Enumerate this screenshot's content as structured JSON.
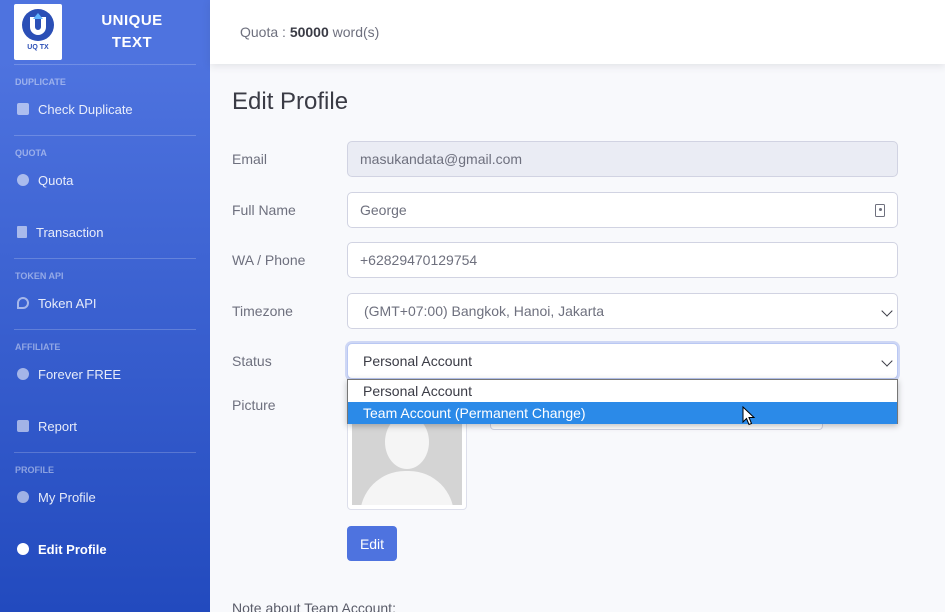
{
  "brand": {
    "logo_text": "UQ TX",
    "name_line1": "UNIQUE",
    "name_line2": "TEXT"
  },
  "sidebar": {
    "sections": [
      {
        "heading": "DUPLICATE",
        "items": [
          {
            "label": "Check Duplicate",
            "icon": "document-icon"
          }
        ]
      },
      {
        "heading": "QUOTA",
        "items": [
          {
            "label": "Quota",
            "icon": "plus-circle-icon"
          },
          {
            "label": "Transaction",
            "icon": "file-icon"
          }
        ]
      },
      {
        "heading": "TOKEN API",
        "items": [
          {
            "label": "Token API",
            "icon": "key-icon"
          }
        ]
      },
      {
        "heading": "AFFILIATE",
        "items": [
          {
            "label": "Forever FREE",
            "icon": "gem-icon"
          },
          {
            "label": "Report",
            "icon": "thumbs-up-icon"
          }
        ]
      },
      {
        "heading": "PROFILE",
        "items": [
          {
            "label": "My Profile",
            "icon": "user-icon"
          },
          {
            "label": "Edit Profile",
            "icon": "user-edit-icon"
          }
        ]
      }
    ]
  },
  "topbar": {
    "quota_prefix": "Quota : ",
    "quota_value": "50000",
    "quota_suffix": " word(s)"
  },
  "form": {
    "title": "Edit Profile",
    "email_label": "Email",
    "email_value": "masukandata@gmail.com",
    "fullname_label": "Full Name",
    "fullname_value": "George",
    "phone_label": "WA / Phone",
    "phone_value": "+62829470129754",
    "timezone_label": "Timezone",
    "timezone_value": "(GMT+07:00) Bangkok, Hanoi, Jakarta",
    "status_label": "Status",
    "status_value": "Personal Account",
    "status_options": [
      "Personal Account",
      "Team Account (Permanent Change)"
    ],
    "picture_label": "Picture",
    "edit_button": "Edit",
    "note": "Note about Team Account:"
  },
  "colors": {
    "primary": "#4e73df",
    "highlight": "#2b8ae8"
  }
}
